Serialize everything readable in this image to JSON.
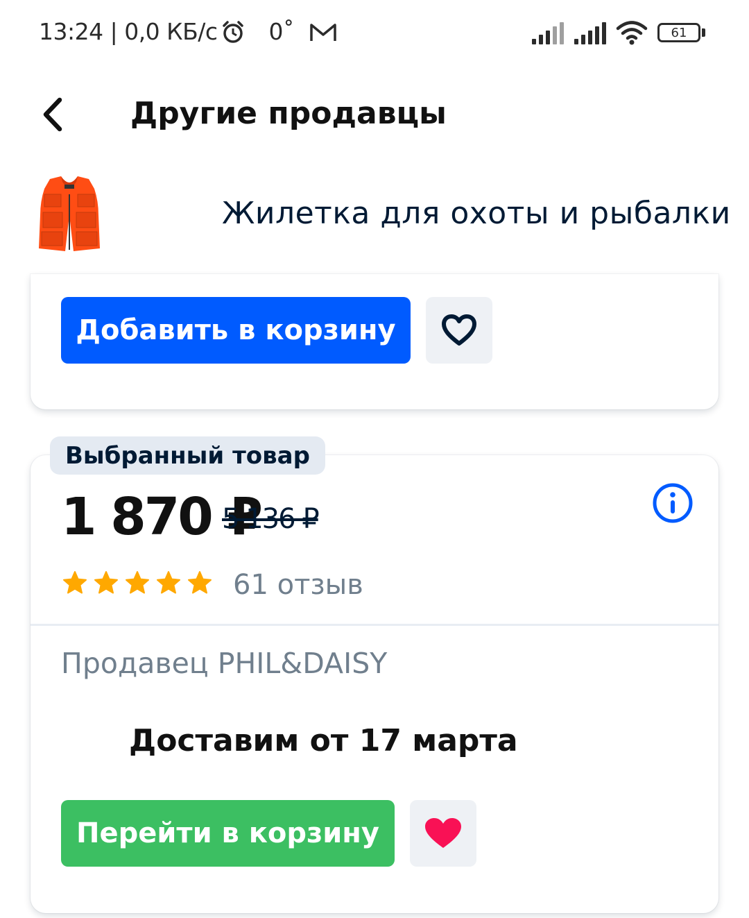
{
  "status_bar": {
    "time_speed": "13:24 | 0,0 КБ/с",
    "temperature": "0˚",
    "battery": "61",
    "icons": [
      "alarm-icon",
      "mail-icon",
      "signal-icon",
      "signal-icon",
      "wifi-icon",
      "battery-icon"
    ]
  },
  "header": {
    "title": "Другие продавцы",
    "back_icon": "chevron-left-icon"
  },
  "product": {
    "name": "Жилетка для охоты и рыбалки",
    "thumbnail": "orange-vest-image",
    "thumbnail_color": "#ff4d14"
  },
  "card_top": {
    "add_to_cart_label": "Добавить в корзину",
    "favorite_icon": "heart-outline-icon"
  },
  "selected_offer": {
    "badge": "Выбранный товар",
    "price": "1 870 ₽",
    "old_price": "5 136 ₽",
    "info_icon": "info-icon",
    "rating_stars": 5,
    "reviews": "61 отзыв",
    "seller": "Продавец PHIL&DAISY",
    "delivery": "Доставим от 17 марта",
    "go_to_cart_label": "Перейти в корзину",
    "favorite_icon": "heart-filled-icon"
  },
  "colors": {
    "primary_blue": "#005bff",
    "cart_green": "#3cbf62",
    "favorite_pink": "#f91155",
    "star": "#ffa800"
  }
}
